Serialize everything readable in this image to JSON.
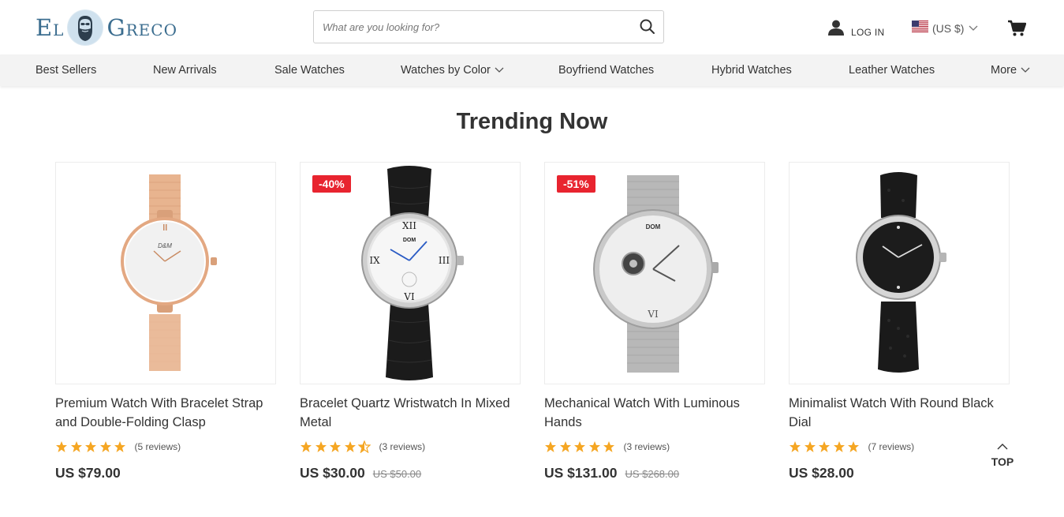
{
  "header": {
    "logo_left": "El",
    "logo_right": "Greco",
    "search_placeholder": "What are you looking for?",
    "login_label": "LOG IN",
    "currency_label": "(US $)"
  },
  "nav": {
    "items": [
      "Best Sellers",
      "New Arrivals",
      "Sale Watches",
      "Watches by Color",
      "Boyfriend Watches",
      "Hybrid Watches",
      "Leather Watches",
      "More"
    ]
  },
  "main": {
    "heading": "Trending Now",
    "products": [
      {
        "title": "Premium Watch With Bracelet Strap and Double-Folding Clasp",
        "rating": 5,
        "reviews": "(5 reviews)",
        "price": "US $79.00",
        "old_price": "",
        "badge": ""
      },
      {
        "title": "Bracelet Quartz Wristwatch In Mixed Metal",
        "rating": 4.5,
        "reviews": "(3 reviews)",
        "price": "US $30.00",
        "old_price": "US $50.00",
        "badge": "-40%"
      },
      {
        "title": "Mechanical Watch With Luminous Hands",
        "rating": 5,
        "reviews": "(3 reviews)",
        "price": "US $131.00",
        "old_price": "US $268.00",
        "badge": "-51%"
      },
      {
        "title": "Minimalist Watch With Round Black Dial",
        "rating": 5,
        "reviews": "(7 reviews)",
        "price": "US $28.00",
        "old_price": "",
        "badge": ""
      }
    ]
  },
  "top_button_label": "TOP",
  "colors": {
    "accent": "#3b6d8f",
    "badge": "#e8242f",
    "star": "#f5a623"
  }
}
